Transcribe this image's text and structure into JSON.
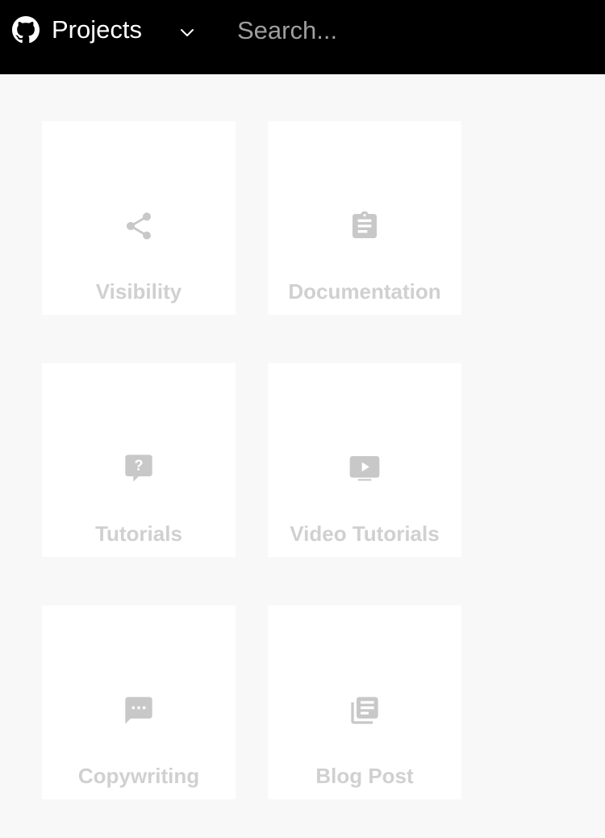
{
  "header": {
    "logo_icon": "github-icon",
    "title": "Projects",
    "dropdown_icon": "chevron-down-icon",
    "search_placeholder": "Search..."
  },
  "colors": {
    "header_bg": "#000000",
    "page_bg": "#f8f8f8",
    "card_bg": "#ffffff",
    "card_content": "#d0d0d0"
  },
  "cards": [
    {
      "label": "Visibility",
      "icon": "share-icon"
    },
    {
      "label": "Documentation",
      "icon": "clipboard-icon"
    },
    {
      "label": "Tutorials",
      "icon": "question-chat-icon"
    },
    {
      "label": "Video Tutorials",
      "icon": "video-play-icon"
    },
    {
      "label": "Copywriting",
      "icon": "chat-dots-icon"
    },
    {
      "label": "Blog Post",
      "icon": "library-books-icon"
    }
  ]
}
